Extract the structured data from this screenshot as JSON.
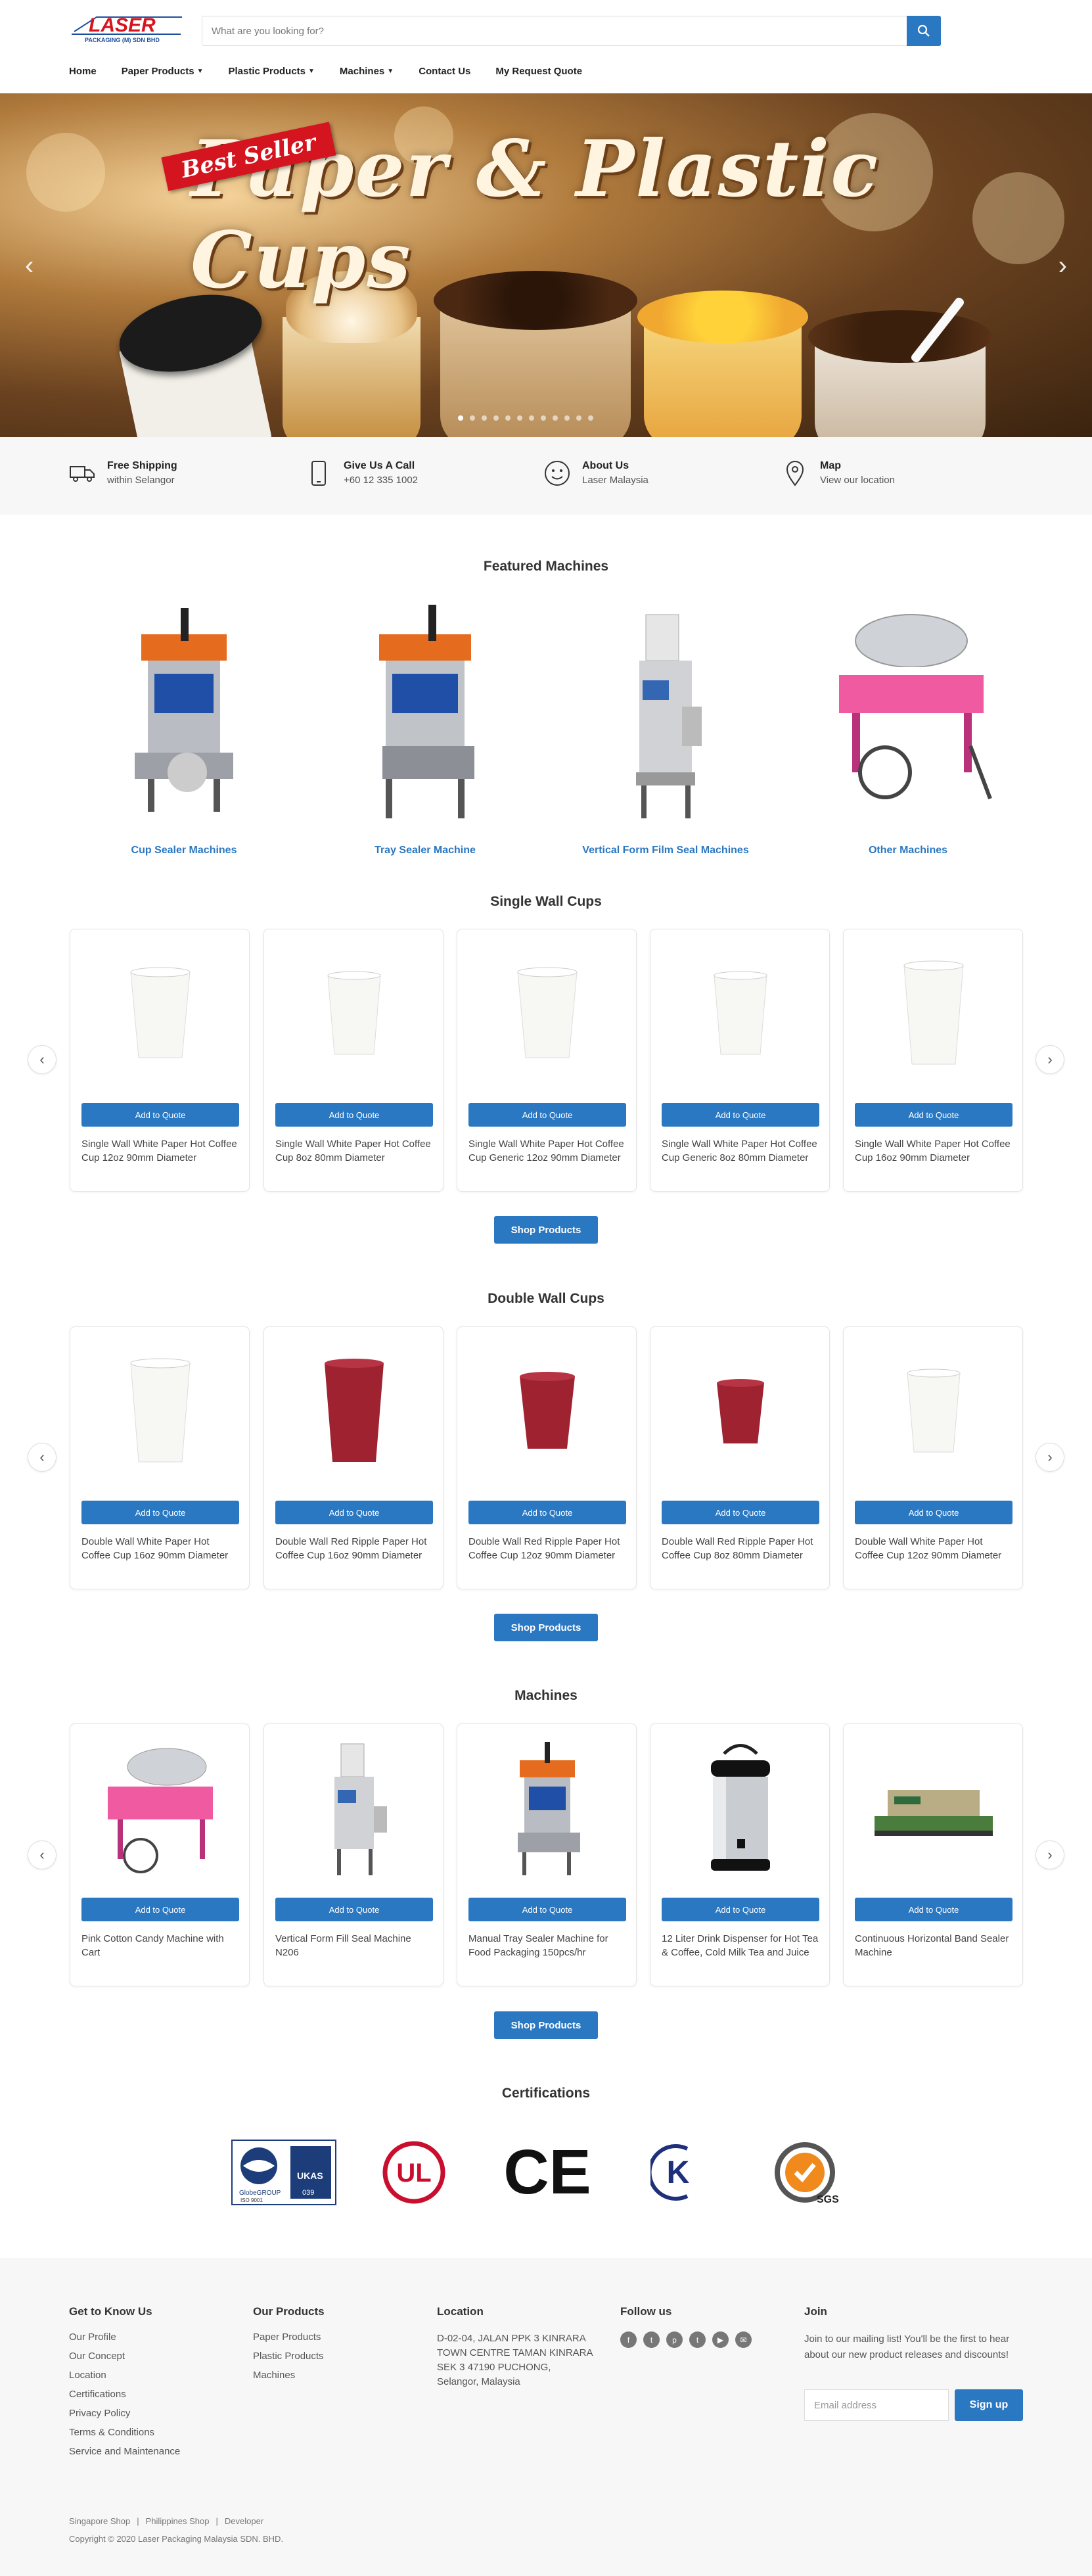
{
  "header": {
    "logo_text": "LASER",
    "logo_sub": "PACKAGING (M) SDN BHD",
    "search_placeholder": "What are you looking for?"
  },
  "nav": [
    {
      "label": "Home",
      "dropdown": false
    },
    {
      "label": "Paper Products",
      "dropdown": true
    },
    {
      "label": "Plastic Products",
      "dropdown": true
    },
    {
      "label": "Machines",
      "dropdown": true
    },
    {
      "label": "Contact Us",
      "dropdown": false
    },
    {
      "label": "My Request Quote",
      "dropdown": false
    }
  ],
  "hero": {
    "badge": "Best Seller",
    "title": "Paper & Plastic Cups",
    "slide_count": 12,
    "active_slide": 1
  },
  "features": [
    {
      "title": "Free Shipping",
      "sub": "within Selangor",
      "icon": "truck-icon"
    },
    {
      "title": "Give Us A Call",
      "sub": "+60 12 335 1002",
      "icon": "phone-icon"
    },
    {
      "title": "About Us",
      "sub": "Laser Malaysia",
      "icon": "smiley-icon"
    },
    {
      "title": "Map",
      "sub": "View our location",
      "icon": "map-pin-icon"
    }
  ],
  "featured_machines": {
    "title": "Featured Machines",
    "items": [
      {
        "label": "Cup Sealer Machines"
      },
      {
        "label": "Tray Sealer Machine"
      },
      {
        "label": "Vertical Form Film Seal Machines"
      },
      {
        "label": "Other Machines"
      }
    ]
  },
  "add_to_quote": "Add to Quote",
  "shop_products": "Shop Products",
  "single_wall": {
    "title": "Single Wall Cups",
    "products": [
      {
        "name": "Single Wall White Paper Hot Coffee Cup 12oz 90mm Diameter"
      },
      {
        "name": "Single Wall White Paper Hot Coffee Cup 8oz 80mm Diameter"
      },
      {
        "name": "Single Wall White Paper Hot Coffee Cup Generic 12oz 90mm Diameter"
      },
      {
        "name": "Single Wall White Paper Hot Coffee Cup Generic 8oz 80mm Diameter"
      },
      {
        "name": "Single Wall White Paper Hot Coffee Cup 16oz 90mm Diameter"
      }
    ]
  },
  "double_wall": {
    "title": "Double Wall Cups",
    "products": [
      {
        "name": "Double Wall White Paper Hot Coffee Cup 16oz 90mm Diameter"
      },
      {
        "name": "Double Wall Red Ripple Paper Hot Coffee Cup 16oz 90mm Diameter"
      },
      {
        "name": "Double Wall Red Ripple Paper Hot Coffee Cup 12oz 90mm Diameter"
      },
      {
        "name": "Double Wall Red Ripple Paper Hot Coffee Cup 8oz 80mm Diameter"
      },
      {
        "name": "Double Wall White Paper Hot Coffee Cup 12oz 90mm Diameter"
      }
    ]
  },
  "machines": {
    "title": "Machines",
    "products": [
      {
        "name": "Pink Cotton Candy Machine with Cart"
      },
      {
        "name": "Vertical Form Fill Seal Machine N206"
      },
      {
        "name": "Manual Tray Sealer Machine for Food Packaging 150pcs/hr"
      },
      {
        "name": "12 Liter Drink Dispenser for Hot Tea & Coffee, Cold Milk Tea and Juice"
      },
      {
        "name": "Continuous Horizontal Band Sealer Machine"
      }
    ]
  },
  "certifications": {
    "title": "Certifications",
    "items": [
      {
        "name": "iso-9001-ukas-badge",
        "text1": "GlobeGROUP",
        "text2": "ISO 9001",
        "text3": "UKAS",
        "text4": "039"
      },
      {
        "name": "ul-logo",
        "text": "UL"
      },
      {
        "name": "ce-logo",
        "text": "CE"
      },
      {
        "name": "kc-logo",
        "text": "K"
      },
      {
        "name": "sgs-logo",
        "text": "SGS"
      }
    ]
  },
  "footer": {
    "col1": {
      "title": "Get to Know Us",
      "links": [
        "Our Profile",
        "Our Concept",
        "Location",
        "Certifications",
        "Privacy Policy",
        "Terms & Conditions",
        "Service and Maintenance"
      ]
    },
    "col2": {
      "title": "Our Products",
      "links": [
        "Paper Products",
        "Plastic Products",
        "Machines"
      ]
    },
    "col3": {
      "title": "Location",
      "address": "D-02-04, JALAN PPK 3 KINRARA TOWN CENTRE TAMAN KINRARA SEK 3 47190 PUCHONG, Selangor, Malaysia"
    },
    "col4": {
      "title": "Follow us",
      "icons": [
        "facebook-icon",
        "twitter-icon",
        "pinterest-icon",
        "tumblr-icon",
        "youtube-icon",
        "email-icon"
      ]
    },
    "col5": {
      "title": "Join",
      "text": "Join to our mailing list! You'll be the first to hear about our new product releases and discounts!",
      "email_placeholder": "Email address",
      "signup": "Sign up"
    },
    "bottom_links": [
      "Singapore Shop",
      "Philippines Shop",
      "Developer"
    ],
    "copyright": "Copyright © 2020 Laser Packaging Malaysia SDN. BHD."
  },
  "colors": {
    "accent": "#2a77c2",
    "brand_red": "#d4141e"
  }
}
